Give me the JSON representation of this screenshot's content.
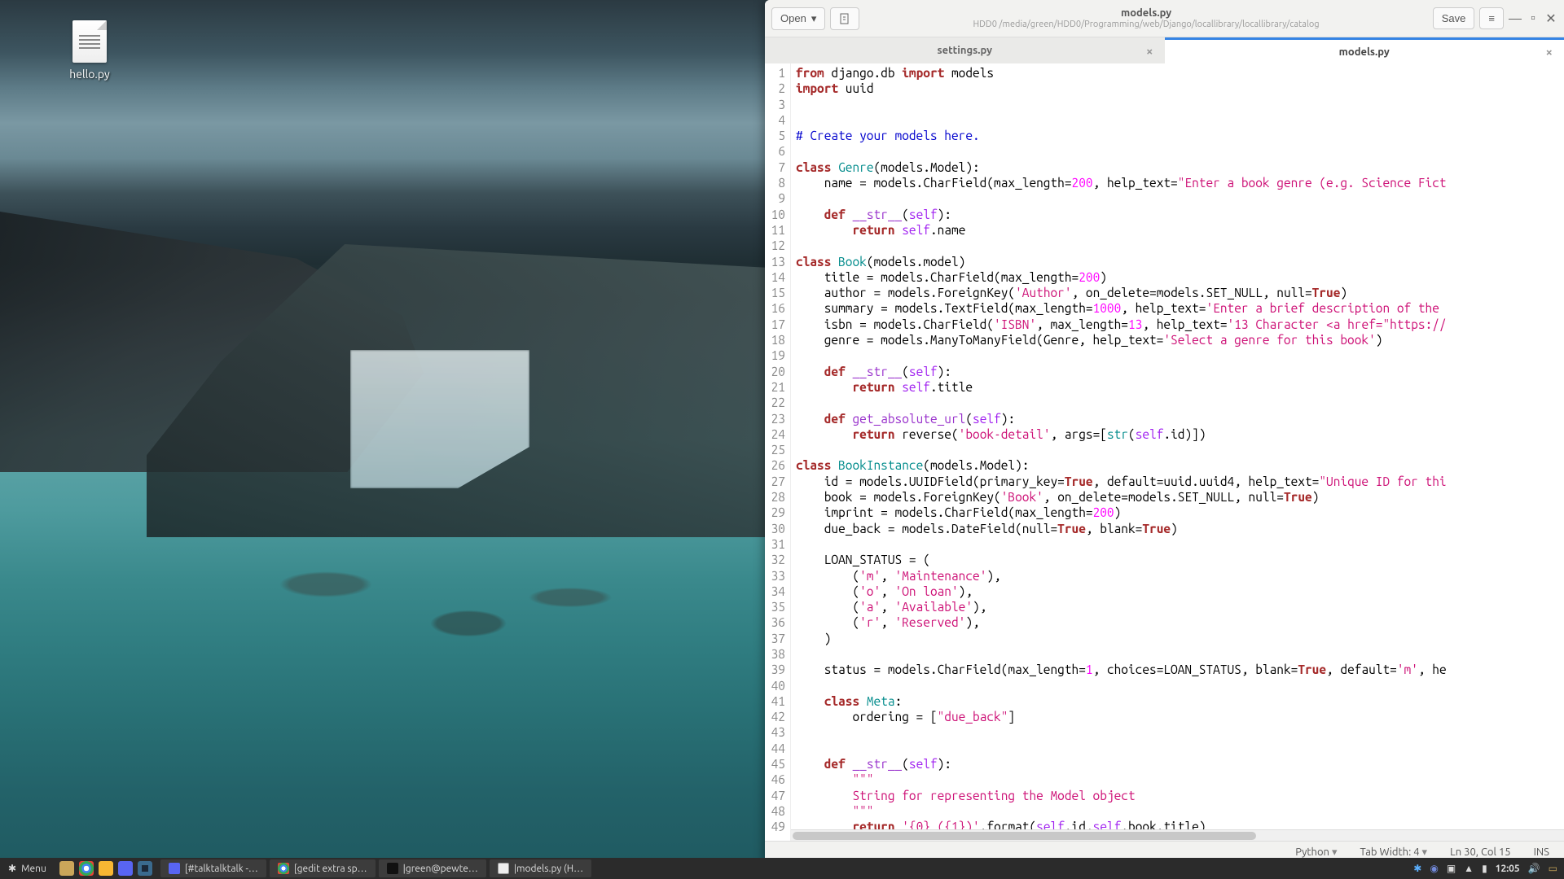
{
  "desktop": {
    "icon_label": "hello.py"
  },
  "editor": {
    "title": "models.py",
    "path": "HDD0 /media/green/HDD0/Programming/web/Django/locallibrary/locallibrary/catalog",
    "open_label": "Open",
    "save_label": "Save",
    "tabs": [
      {
        "label": "settings.py",
        "active": false
      },
      {
        "label": "models.py",
        "active": true
      }
    ],
    "status": {
      "language": "Python",
      "tab_width": "Tab Width: 4",
      "cursor": "Ln 30, Col 15",
      "mode": "INS"
    },
    "line_count": 49
  },
  "taskbar": {
    "menu_label": "Menu",
    "items": [
      {
        "label": "[#talktalktalk -…",
        "icon": "discord"
      },
      {
        "label": "[gedit extra sp…",
        "icon": "chrome"
      },
      {
        "label": "|green@pewte…",
        "icon": "terminal"
      },
      {
        "label": "|models.py (H…",
        "icon": "gedit"
      }
    ],
    "clock": "12:05"
  }
}
